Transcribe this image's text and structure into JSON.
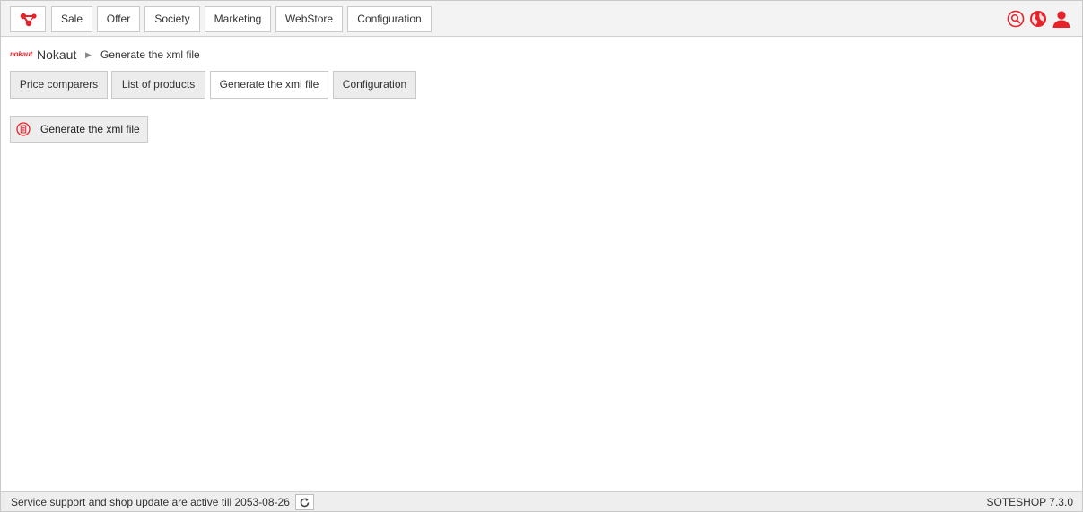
{
  "topbar": {
    "logo_icon": "brand-network-icon",
    "menu": [
      {
        "label": "Sale"
      },
      {
        "label": "Offer"
      },
      {
        "label": "Society"
      },
      {
        "label": "Marketing"
      },
      {
        "label": "WebStore"
      },
      {
        "label": "Configuration"
      }
    ],
    "right_icons": [
      "search-icon",
      "globe-icon",
      "user-icon"
    ],
    "accent_color": "#e6222b"
  },
  "breadcrumb": {
    "brand_logo": "nokaut",
    "section": "Nokaut",
    "separator": "▶",
    "current": "Generate the xml file"
  },
  "tabs": [
    {
      "label": "Price comparers",
      "active": false
    },
    {
      "label": "List of products",
      "active": false
    },
    {
      "label": "Generate the xml file",
      "active": true
    },
    {
      "label": "Configuration",
      "active": false
    }
  ],
  "action": {
    "label": "Generate the xml file",
    "icon": "generate-file-icon"
  },
  "footer": {
    "support_text": "Service support and shop update are active till 2053-08-26",
    "refresh_icon": "refresh-icon",
    "version": "SOTESHOP 7.3.0"
  }
}
